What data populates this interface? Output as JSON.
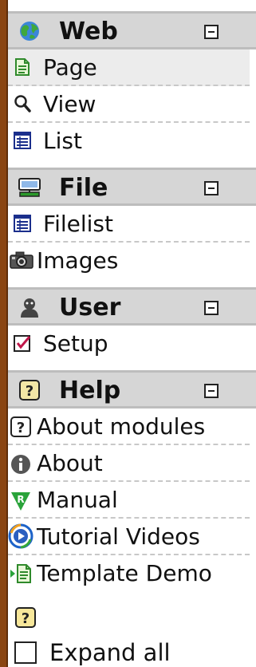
{
  "sections": [
    {
      "title": "Web",
      "icon": "globe-icon",
      "items": [
        {
          "label": "Page",
          "icon": "page-icon",
          "active": true
        },
        {
          "label": "View",
          "icon": "magnifier-icon"
        },
        {
          "label": "List",
          "icon": "list-icon"
        }
      ]
    },
    {
      "title": "File",
      "icon": "filesystem-icon",
      "items": [
        {
          "label": "Filelist",
          "icon": "list-icon"
        },
        {
          "label": "Images",
          "icon": "camera-icon"
        }
      ]
    },
    {
      "title": "User",
      "icon": "user-icon",
      "items": [
        {
          "label": "Setup",
          "icon": "checkbox-checked-icon"
        }
      ]
    },
    {
      "title": "Help",
      "icon": "help-icon",
      "items": [
        {
          "label": "About modules",
          "icon": "help-icon"
        },
        {
          "label": "About",
          "icon": "info-icon"
        },
        {
          "label": "Manual",
          "icon": "manual-icon"
        },
        {
          "label": "Tutorial Videos",
          "icon": "video-play-icon"
        },
        {
          "label": "Template Demo",
          "icon": "template-demo-icon"
        }
      ]
    }
  ],
  "expand_all_label": "Expand all",
  "colors": {
    "border_brown": "#8a4512",
    "header_bg": "#d6d6d6",
    "active_bg": "#ececec"
  }
}
